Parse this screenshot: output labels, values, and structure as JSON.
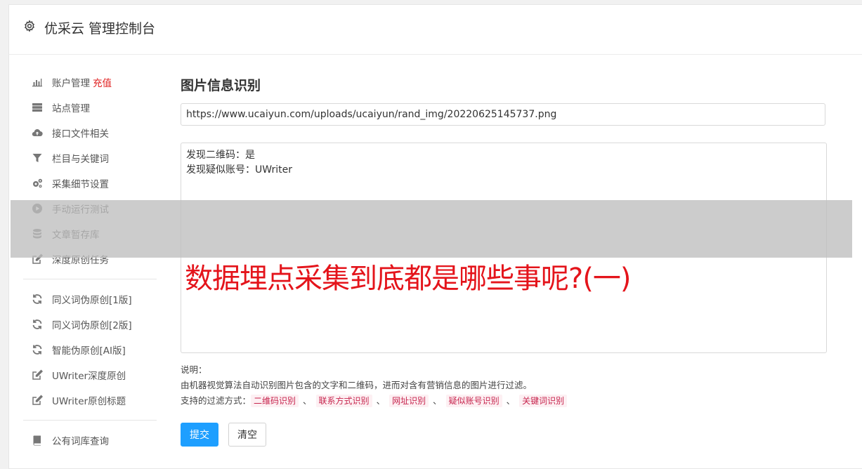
{
  "header": {
    "title": "优采云 管理控制台",
    "icon": "gear-icon"
  },
  "sidebar": {
    "groups": [
      [
        {
          "label": "账户管理",
          "badge": "充值",
          "icon": "bar-chart-icon"
        },
        {
          "label": "站点管理",
          "icon": "server-icon"
        },
        {
          "label": "接口文件相关",
          "icon": "cloud-upload-icon"
        },
        {
          "label": "栏目与关键词",
          "icon": "filter-icon"
        },
        {
          "label": "采集细节设置",
          "icon": "gears-icon"
        },
        {
          "label": "手动运行测试",
          "icon": "play-circle-icon"
        },
        {
          "label": "文章暂存库",
          "icon": "database-icon"
        },
        {
          "label": "深度原创任务",
          "icon": "edit-icon"
        }
      ],
      [
        {
          "label": "同义词伪原创[1版]",
          "icon": "refresh-icon"
        },
        {
          "label": "同义词伪原创[2版]",
          "icon": "refresh-icon"
        },
        {
          "label": "智能伪原创[AI版]",
          "icon": "refresh-icon"
        },
        {
          "label": "UWriter深度原创",
          "icon": "edit-icon"
        },
        {
          "label": "UWriter原创标题",
          "icon": "edit-icon"
        }
      ],
      [
        {
          "label": "公有词库查询",
          "icon": "book-icon"
        }
      ]
    ]
  },
  "main": {
    "title": "图片信息识别",
    "url_value": "https://www.ucaiyun.com/uploads/ucaiyun/rand_img/20220625145737.png",
    "result_lines": [
      "发现二维码：是",
      "发现疑似账号：UWriter"
    ],
    "notes_label": "说明：",
    "notes_text": "由机器视觉算法自动识别图片包含的文字和二维码，进而对含有营销信息的图片进行过滤。",
    "filters_label": "支持的过滤方式：",
    "filters": [
      "二维码识别",
      "联系方式识别",
      "网址识别",
      "疑似账号识别",
      "关键词识别"
    ],
    "filter_separator": "、",
    "submit_label": "提交",
    "clear_label": "清空"
  },
  "overlay": {
    "text": "数据埋点采集到底都是哪些事呢?(一)"
  },
  "colors": {
    "accent": "#1e9fff",
    "badge": "#e02020",
    "overlay_text": "#e4141b"
  }
}
